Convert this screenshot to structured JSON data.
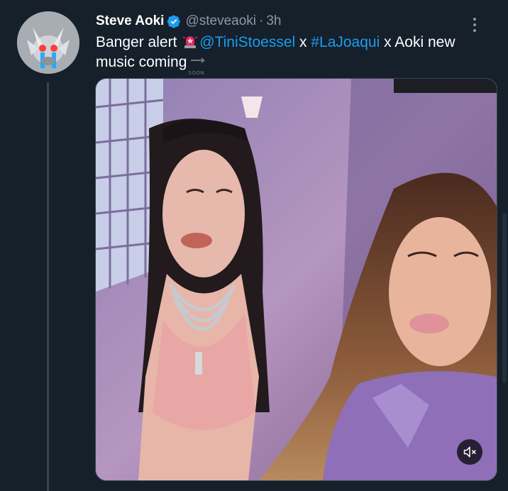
{
  "tweet": {
    "author_name": "Steve Aoki",
    "handle": "@steveaoki",
    "separator": "·",
    "time": "3h",
    "text_segments": [
      {
        "text": "Banger alert ",
        "kind": "plain"
      },
      {
        "text": "@TiniStoessel",
        "kind": "mention"
      },
      {
        "text": " x ",
        "kind": "plain"
      },
      {
        "text": "#LaJoaqui",
        "kind": "hashtag"
      },
      {
        "text": " x Aoki new music coming",
        "kind": "plain"
      }
    ],
    "soon_label": "SOON"
  },
  "icons": {
    "verified": "verified-badge-icon",
    "more": "more-options-icon",
    "siren": "police-light-emoji-icon",
    "soon": "soon-arrow-emoji-icon",
    "mute": "muted-speaker-icon"
  },
  "colors": {
    "background": "#15202b",
    "link": "#1d9bf0",
    "secondary_text": "#8b98a5",
    "divider": "#38444d",
    "verified": "#1d9bf0"
  }
}
